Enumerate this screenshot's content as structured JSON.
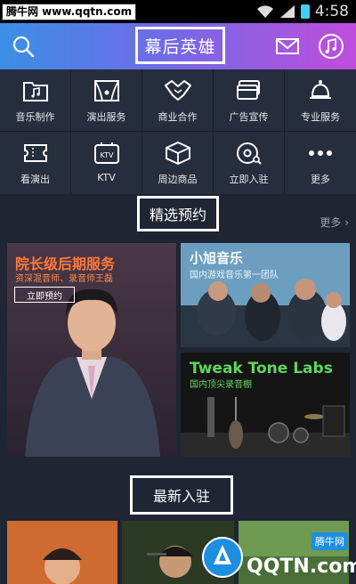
{
  "status_bar": {
    "watermark": "腾牛网 www.qqtn.com",
    "time": "4:58"
  },
  "header": {
    "title": "幕后英雄",
    "icons": [
      "search-icon",
      "mail-icon",
      "music-icon"
    ],
    "gradient": [
      "#3b8fe6",
      "#6f6be6",
      "#c14ddd"
    ]
  },
  "grid": {
    "items": [
      {
        "label": "音乐制作",
        "icon": "music-folder-icon"
      },
      {
        "label": "演出服务",
        "icon": "stage-icon"
      },
      {
        "label": "商业合作",
        "icon": "handshake-icon"
      },
      {
        "label": "广告宣传",
        "icon": "card-icon"
      },
      {
        "label": "专业服务",
        "icon": "bell-icon"
      },
      {
        "label": "看演出",
        "icon": "ticket-icon"
      },
      {
        "label": "KTV",
        "icon": "ktv-icon"
      },
      {
        "label": "周边商品",
        "icon": "box-icon"
      },
      {
        "label": "立即入驻",
        "icon": "vinyl-icon"
      },
      {
        "label": "更多",
        "icon": "more-dots-icon"
      }
    ]
  },
  "featured": {
    "title": "精选预约",
    "more": "更多",
    "main_card": {
      "title": "院长级后期服务",
      "subtitle": "资深混音师、录音师王磊",
      "button": "立即预约"
    },
    "card_top_right": {
      "title": "小旭音乐",
      "subtitle": "国内游戏音乐第一团队"
    },
    "card_bottom_right": {
      "title": "Tweak Tone Labs",
      "subtitle": "国内顶尖录音棚"
    }
  },
  "latest": {
    "title": "最新入驻"
  },
  "bottom_watermark": {
    "brand": "QQTN.com",
    "tag": "腾牛网"
  }
}
